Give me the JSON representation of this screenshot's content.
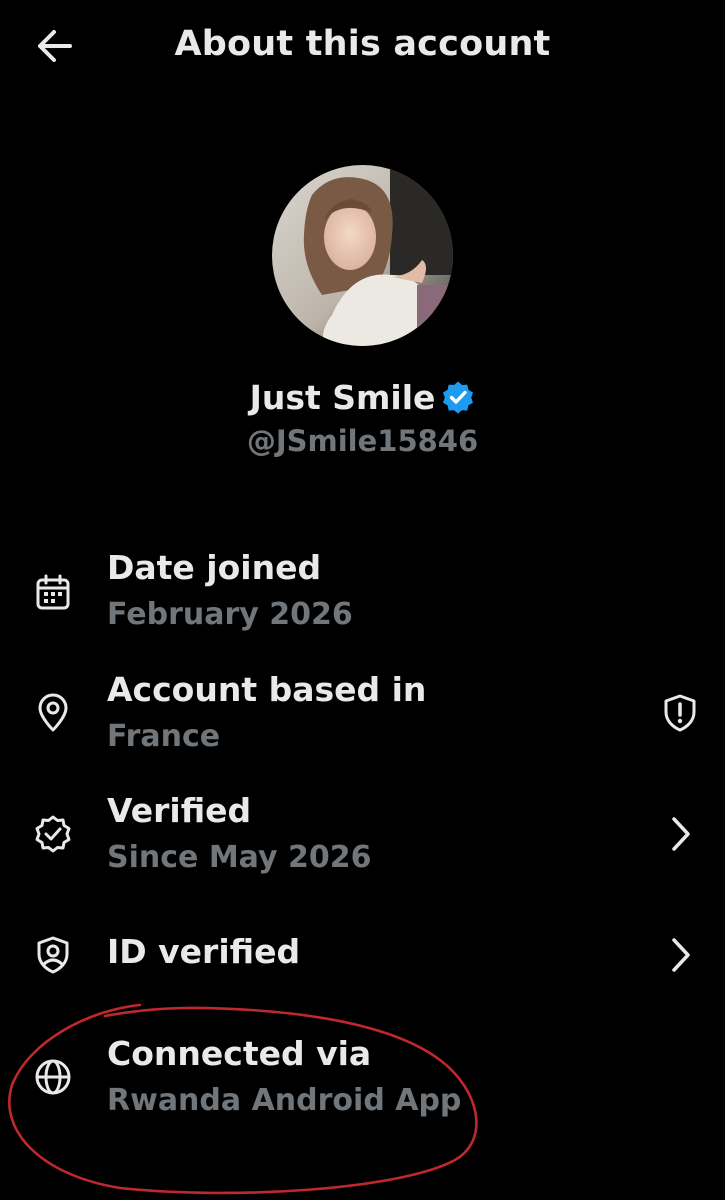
{
  "header": {
    "back_icon": "arrow-left-icon",
    "title": "About this account"
  },
  "profile": {
    "display_name": "Just Smile",
    "verified_badge_icon": "verified-checkmark-icon",
    "handle": "@JSmile15846",
    "badge_color": "#1d9bf0"
  },
  "rows": [
    {
      "icon": "calendar-icon",
      "title": "Date joined",
      "subtitle": "February 2026"
    },
    {
      "icon": "location-pin-icon",
      "title": "Account based in",
      "subtitle": "France",
      "trailing_icon": "shield-alert-icon"
    },
    {
      "icon": "verified-seal-icon",
      "title": "Verified",
      "subtitle": "Since May 2026",
      "trailing_icon": "chevron-right-icon"
    },
    {
      "icon": "id-shield-icon",
      "title": "ID verified",
      "trailing_icon": "chevron-right-icon"
    },
    {
      "icon": "globe-icon",
      "title": "Connected via",
      "subtitle": "Rwanda Android App"
    }
  ],
  "colors": {
    "background": "#000000",
    "primary_text": "#e7e9ea",
    "secondary_text": "#71767b",
    "annotation_circle": "#c0282d"
  }
}
